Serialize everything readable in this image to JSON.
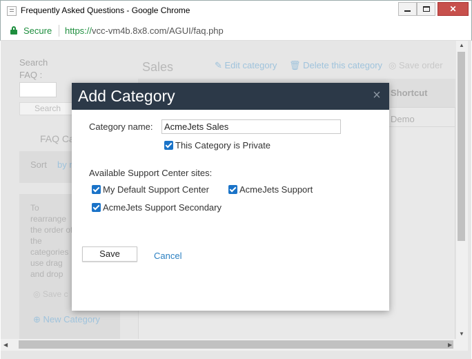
{
  "window": {
    "title": "Frequently Asked Questions - Google Chrome",
    "minimize_glyph": "",
    "maximize_glyph": "",
    "close_glyph": "✕"
  },
  "address": {
    "secure_label": "Secure",
    "url_scheme": "https://",
    "url_rest": "vcc-vm4b.8x8.com/AGUI/faq.php"
  },
  "background": {
    "search_label": "Search FAQ :",
    "search_button": "Search",
    "faq_categories_heading": "FAQ Ca",
    "sort_label": "Sort",
    "sort_by_link": "by n",
    "help_text": "To rearrange the order of the categories use drag and drop",
    "save_link": "Save c",
    "new_category_link": "New Category",
    "category_title": "Sales",
    "edit_category": "Edit category",
    "delete_category": "Delete this category",
    "save_order": "Save order",
    "column_shortcut": "Shortcut",
    "row_demo": "Demo"
  },
  "modal": {
    "title": "Add Category",
    "close_glyph": "×",
    "category_name_label": "Category name:",
    "category_name_value": "AcmeJets Sales",
    "private_label": "This Category is Private",
    "private_checked": true,
    "available_sites_label": "Available Support Center sites:",
    "sites": [
      {
        "label": "My Default Support Center",
        "checked": true
      },
      {
        "label": "AcmeJets Support",
        "checked": true
      },
      {
        "label": "AcmeJets Support Secondary",
        "checked": true
      }
    ],
    "save_button": "Save",
    "cancel_link": "Cancel"
  },
  "colors": {
    "modal_header": "#2c3948",
    "checkbox": "#1a73c8",
    "link": "#2a7fc1",
    "secure": "#1e8e3e"
  }
}
